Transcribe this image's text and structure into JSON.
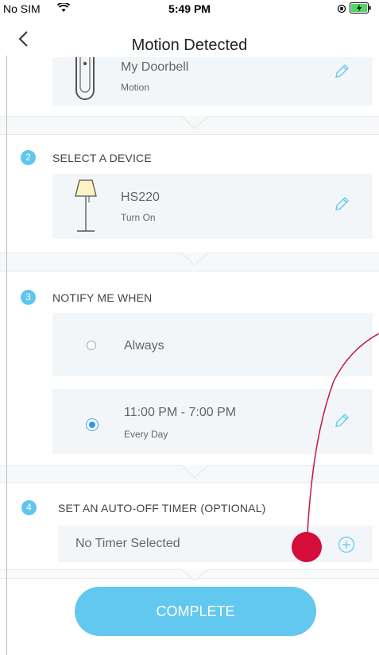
{
  "status": {
    "carrier": "No SIM",
    "time": "5:49 PM"
  },
  "nav": {
    "title": "Motion Detected"
  },
  "trigger": {
    "name": "My Doorbell",
    "sub": "Motion"
  },
  "step2": {
    "number": "2",
    "title": "SELECT A DEVICE",
    "device": "HS220",
    "action": "Turn On"
  },
  "step3": {
    "number": "3",
    "title": "NOTIFY ME WHEN",
    "option1": "Always",
    "option2": "11:00 PM - 7:00 PM",
    "option2_sub": "Every Day"
  },
  "step4": {
    "number": "4",
    "title": "SET AN AUTO-OFF TIMER (OPTIONAL)",
    "timer_value": "No Timer Selected"
  },
  "actions": {
    "complete": "COMPLETE"
  },
  "colors": {
    "accent": "#63c8ef",
    "annotation": "#d40d3b"
  }
}
